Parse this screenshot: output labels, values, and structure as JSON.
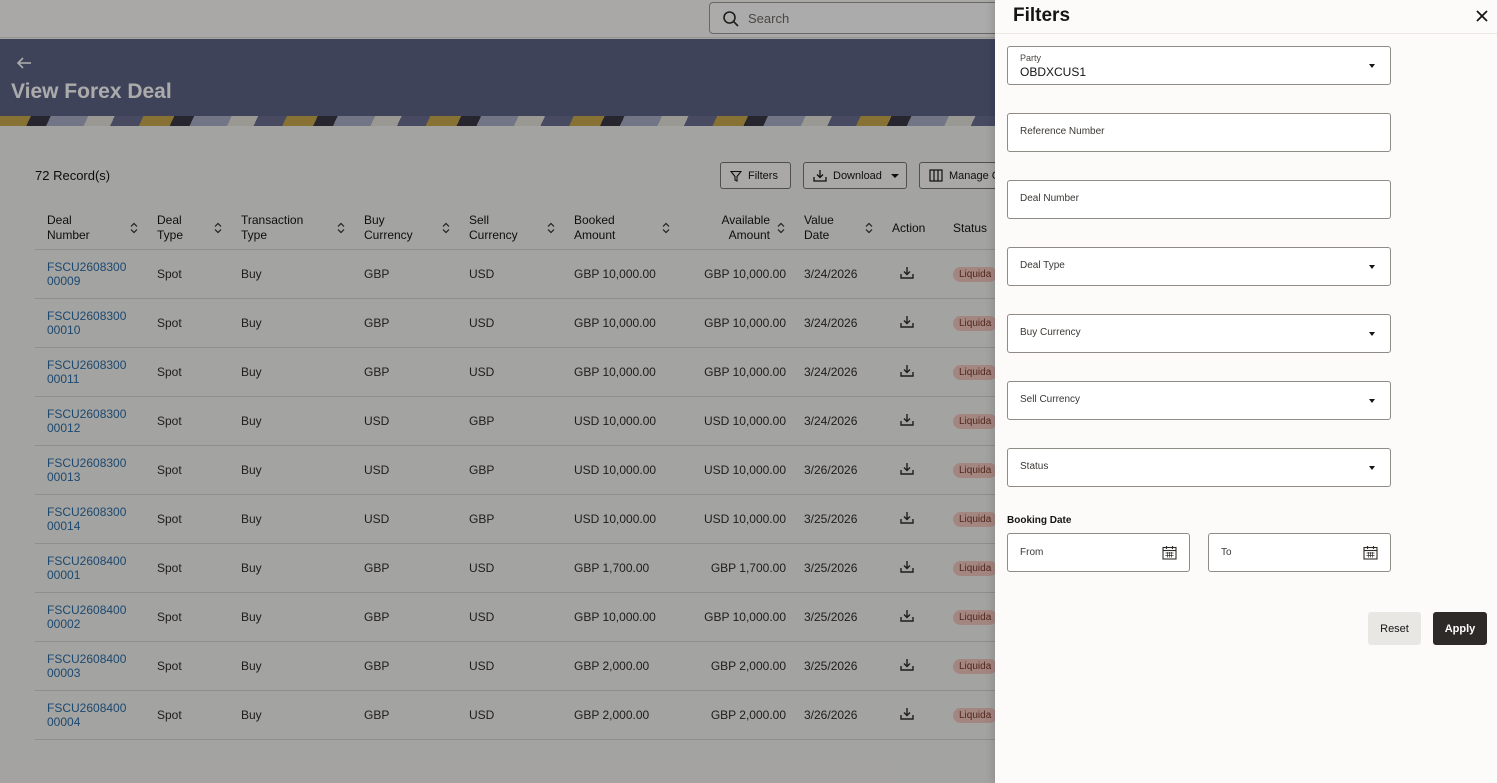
{
  "search": {
    "placeholder": "Search"
  },
  "page": {
    "title": "View Forex Deal"
  },
  "toolbar": {
    "records": "72 Record(s)",
    "filters_label": "Filters",
    "download_label": "Download",
    "manage_label": "Manage C"
  },
  "table": {
    "headers": {
      "deal_number": "Deal Number",
      "deal_type": "Deal Type",
      "transaction_type": "Transaction Type",
      "buy_currency": "Buy Currency",
      "sell_currency": "Sell Currency",
      "booked_amount": "Booked Amount",
      "available_amount": "Available Amount",
      "value_date": "Value Date",
      "action": "Action",
      "status": "Status"
    },
    "rows": [
      {
        "deal_a": "FSCU2608300",
        "deal_b": "00009",
        "type": "Spot",
        "txn": "Buy",
        "buy": "GBP",
        "sell": "USD",
        "booked": "GBP 10,000.00",
        "available": "GBP 10,000.00",
        "date": "3/24/2026",
        "status": "Liquida"
      },
      {
        "deal_a": "FSCU2608300",
        "deal_b": "00010",
        "type": "Spot",
        "txn": "Buy",
        "buy": "GBP",
        "sell": "USD",
        "booked": "GBP 10,000.00",
        "available": "GBP 10,000.00",
        "date": "3/24/2026",
        "status": "Liquida"
      },
      {
        "deal_a": "FSCU2608300",
        "deal_b": "00011",
        "type": "Spot",
        "txn": "Buy",
        "buy": "GBP",
        "sell": "USD",
        "booked": "GBP 10,000.00",
        "available": "GBP 10,000.00",
        "date": "3/24/2026",
        "status": "Liquida"
      },
      {
        "deal_a": "FSCU2608300",
        "deal_b": "00012",
        "type": "Spot",
        "txn": "Buy",
        "buy": "USD",
        "sell": "GBP",
        "booked": "USD 10,000.00",
        "available": "USD 10,000.00",
        "date": "3/24/2026",
        "status": "Liquida"
      },
      {
        "deal_a": "FSCU2608300",
        "deal_b": "00013",
        "type": "Spot",
        "txn": "Buy",
        "buy": "USD",
        "sell": "GBP",
        "booked": "USD 10,000.00",
        "available": "USD 10,000.00",
        "date": "3/26/2026",
        "status": "Liquida"
      },
      {
        "deal_a": "FSCU2608300",
        "deal_b": "00014",
        "type": "Spot",
        "txn": "Buy",
        "buy": "USD",
        "sell": "GBP",
        "booked": "USD 10,000.00",
        "available": "USD 10,000.00",
        "date": "3/25/2026",
        "status": "Liquida"
      },
      {
        "deal_a": "FSCU2608400",
        "deal_b": "00001",
        "type": "Spot",
        "txn": "Buy",
        "buy": "GBP",
        "sell": "USD",
        "booked": "GBP 1,700.00",
        "available": "GBP 1,700.00",
        "date": "3/25/2026",
        "status": "Liquida"
      },
      {
        "deal_a": "FSCU2608400",
        "deal_b": "00002",
        "type": "Spot",
        "txn": "Buy",
        "buy": "GBP",
        "sell": "USD",
        "booked": "GBP 10,000.00",
        "available": "GBP 10,000.00",
        "date": "3/25/2026",
        "status": "Liquida"
      },
      {
        "deal_a": "FSCU2608400",
        "deal_b": "00003",
        "type": "Spot",
        "txn": "Buy",
        "buy": "GBP",
        "sell": "USD",
        "booked": "GBP 2,000.00",
        "available": "GBP 2,000.00",
        "date": "3/25/2026",
        "status": "Liquida"
      },
      {
        "deal_a": "FSCU2608400",
        "deal_b": "00004",
        "type": "Spot",
        "txn": "Buy",
        "buy": "GBP",
        "sell": "USD",
        "booked": "GBP 2,000.00",
        "available": "GBP 2,000.00",
        "date": "3/26/2026",
        "status": "Liquida"
      }
    ]
  },
  "filters": {
    "title": "Filters",
    "party": {
      "label": "Party",
      "value": "OBDXCUS1"
    },
    "reference_number": {
      "label": "Reference Number"
    },
    "deal_number": {
      "label": "Deal Number"
    },
    "deal_type": {
      "label": "Deal Type"
    },
    "buy_currency": {
      "label": "Buy Currency"
    },
    "sell_currency": {
      "label": "Sell Currency"
    },
    "status": {
      "label": "Status"
    },
    "booking_date": {
      "label": "Booking Date",
      "from": "From",
      "to": "To"
    },
    "reset_label": "Reset",
    "apply_label": "Apply"
  },
  "icons": {
    "search": "search-icon",
    "back": "back-arrow-icon",
    "filter": "filter-icon",
    "download": "download-icon",
    "columns": "columns-icon",
    "sort": "sort-icon",
    "close": "close-icon",
    "calendar": "calendar-icon",
    "dropdown": "chevron-down-icon"
  },
  "colors": {
    "banner": "#5f6487",
    "link": "#2b6ea8",
    "status_pill": "#f5c8c0",
    "apply": "#2d2a27"
  }
}
